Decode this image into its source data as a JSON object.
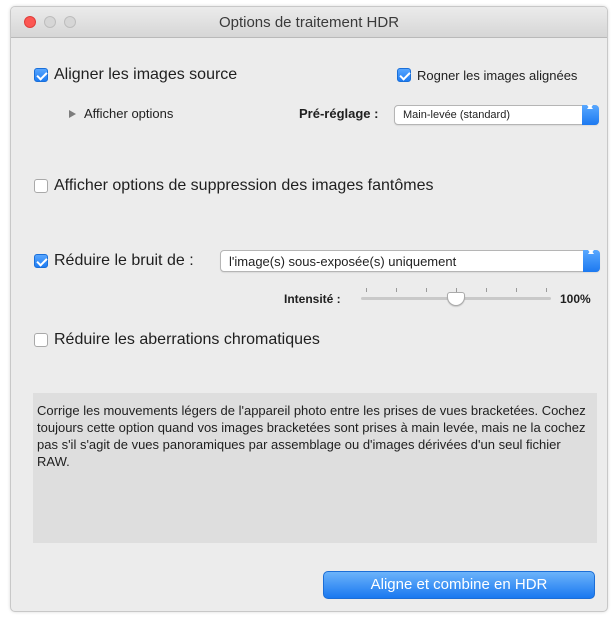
{
  "window": {
    "title": "Options de traitement HDR"
  },
  "align": {
    "label": "Aligner les images source",
    "checked": true,
    "show_options_label": "Afficher options",
    "crop_label": "Rogner les images alignées",
    "crop_checked": true,
    "preset_label": "Pré-réglage :",
    "preset_value": "Main-levée (standard)"
  },
  "ghost": {
    "label": "Afficher options de suppression des images fantômes",
    "checked": false
  },
  "noise": {
    "label": "Réduire le bruit de :",
    "checked": true,
    "target_value": "l'image(s) sous-exposée(s) uniquement",
    "intensity_label": "Intensité :",
    "intensity_value": "100%",
    "intensity_fraction": 0.5
  },
  "chromatic": {
    "label": "Réduire les aberrations chromatiques",
    "checked": false
  },
  "description": {
    "text": "Corrige les mouvements légers de l'appareil photo entre les prises de vues bracketées. Cochez toujours cette option quand vos images bracketées sont prises à main levée, mais ne la cochez pas s'il s'agit de vues panoramiques par assemblage ou d'images dérivées d'un seul fichier RAW."
  },
  "actions": {
    "primary_label": "Aligne et combine en HDR"
  },
  "colors": {
    "accent": "#1e7cf2",
    "close_button": "#fc5753",
    "panel_bg": "#ececec",
    "description_bg": "#dedede"
  }
}
